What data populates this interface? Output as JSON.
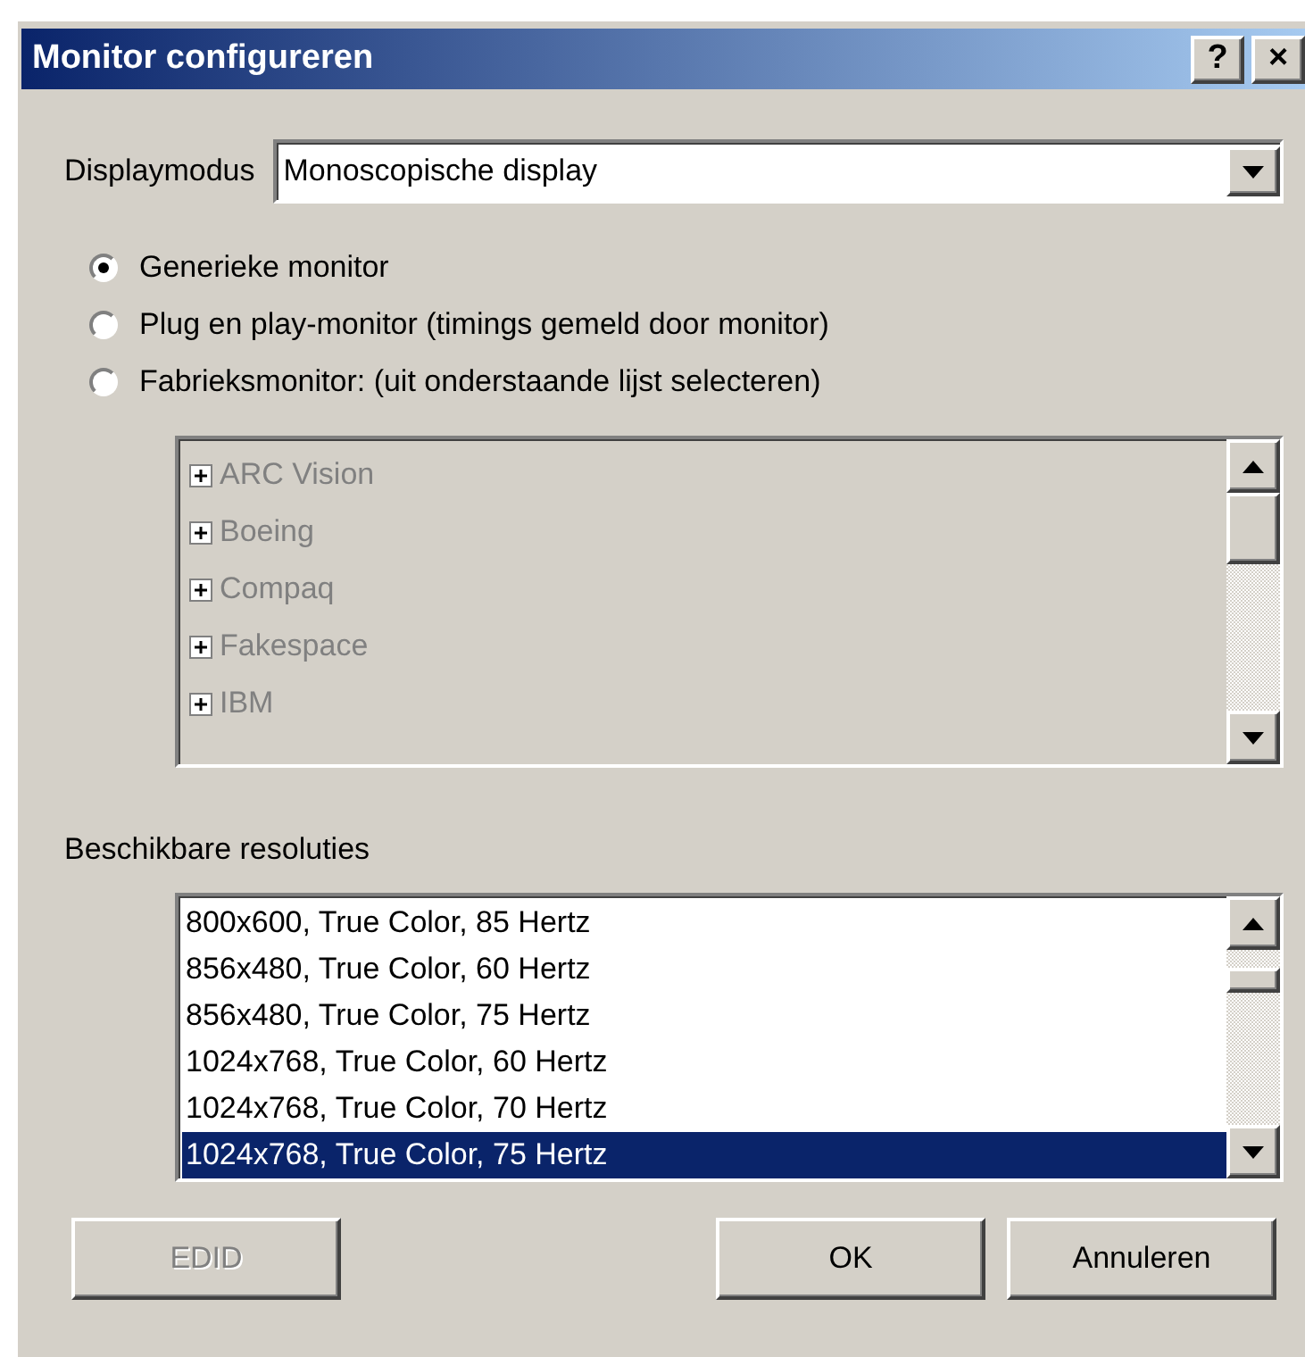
{
  "window": {
    "title": "Monitor configureren",
    "buttons": [
      "?",
      "×"
    ]
  },
  "display_mode": {
    "label": "Displaymodus",
    "value": "Monoscopische display"
  },
  "monitor_type": [
    {
      "label": "Generieke monitor",
      "selected": true
    },
    {
      "label": "Plug en play-monitor (timings gemeld door monitor)",
      "selected": false
    },
    {
      "label": "Fabrieksmonitor: (uit onderstaande lijst selecteren)",
      "selected": false
    }
  ],
  "manufacturer_tree": {
    "disabled": true,
    "items": [
      {
        "label": "ARC Vision",
        "expanded": false
      },
      {
        "label": "Boeing",
        "expanded": false
      },
      {
        "label": "Compaq",
        "expanded": false
      },
      {
        "label": "Fakespace",
        "expanded": false
      },
      {
        "label": "IBM",
        "expanded": false
      }
    ]
  },
  "resolutions": {
    "label": "Beschikbare resoluties",
    "items": [
      {
        "label": "800x600, True Color, 85 Hertz",
        "selected": false
      },
      {
        "label": "856x480, True Color, 60 Hertz",
        "selected": false
      },
      {
        "label": "856x480, True Color, 75 Hertz",
        "selected": false
      },
      {
        "label": "1024x768, True Color, 60 Hertz",
        "selected": false
      },
      {
        "label": "1024x768, True Color, 70 Hertz",
        "selected": false
      },
      {
        "label": "1024x768, True Color, 75 Hertz",
        "selected": true
      }
    ]
  },
  "buttons": [
    {
      "label": "EDID",
      "disabled": true
    },
    {
      "label": "OK",
      "disabled": false
    },
    {
      "label": "Annuleren",
      "disabled": false
    }
  ]
}
